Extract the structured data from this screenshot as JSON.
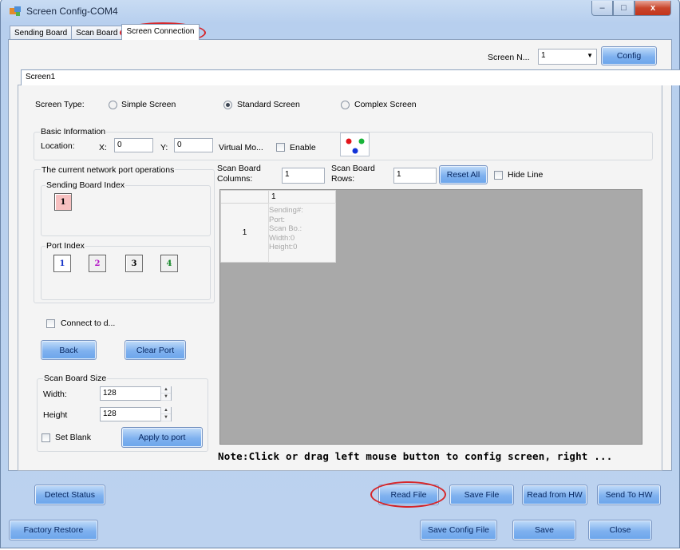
{
  "window": {
    "title": "Screen Config-COM4",
    "min": "–",
    "max": "□",
    "close": "x"
  },
  "tabs": [
    "Sending Board",
    "Scan Board",
    "Screen Connection"
  ],
  "screen_select": {
    "label": "Screen N...",
    "value": "1",
    "config_label": "Config"
  },
  "inner_tab": "Screen1",
  "screen_type": {
    "label": "Screen Type:",
    "options": [
      "Simple Screen",
      "Standard Screen",
      "Complex Screen"
    ],
    "selected": "Standard Screen"
  },
  "basic_info": {
    "title": "Basic Information",
    "location_label": "Location:",
    "x_label": "X:",
    "x_value": "0",
    "y_label": "Y:",
    "y_value": "0",
    "virtual_label": "Virtual Mo...",
    "enable_label": "Enable"
  },
  "network": {
    "title": "The current network port operations",
    "sending_title": "Sending Board Index",
    "sending_value": "1",
    "port_title": "Port Index",
    "ports": [
      "1",
      "2",
      "3",
      "4"
    ],
    "connect_label": "Connect to d...",
    "back_label": "Back",
    "clear_port_label": "Clear Port"
  },
  "scan_size": {
    "title": "Scan Board Size",
    "width_label": "Width:",
    "width_value": "128",
    "height_label": "Height",
    "height_value": "128",
    "set_blank_label": "Set Blank",
    "apply_label": "Apply to port"
  },
  "grid_controls": {
    "columns_label_1": "Scan Board",
    "columns_label_2": "Columns:",
    "columns_value": "1",
    "rows_label_1": "Scan Board",
    "rows_label_2": "Rows:",
    "rows_value": "1",
    "reset_all_label": "Reset All",
    "hide_line_label": "Hide Line"
  },
  "grid": {
    "col_header": "1",
    "row_header": "1",
    "cell_lines": [
      "Sending#:",
      "Port:",
      "Scan Bo.:",
      "Width:0",
      "Height:0"
    ]
  },
  "note": "Note:Click or drag left mouse button to config screen, right ...",
  "bottom_row1": [
    "Detect Status",
    "Read File",
    "Save File",
    "Read from HW",
    "Send To HW"
  ],
  "bottom_row2": [
    "Factory Restore",
    "Save Config File",
    "Save",
    "Close"
  ],
  "colors": {
    "accent_button": "#7fb1ef",
    "highlight_ellipse": "#d6262a",
    "grid_bg": "#a9a9a9"
  }
}
